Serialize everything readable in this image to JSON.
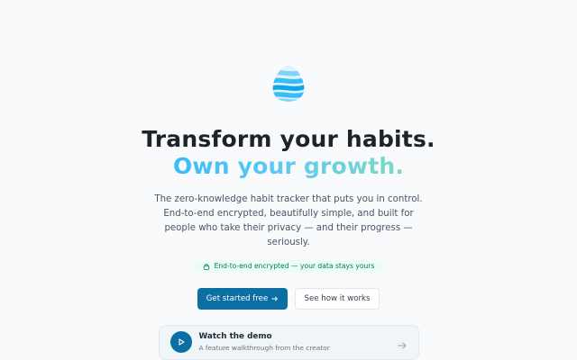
{
  "hero": {
    "title_line1": "Transform your habits.",
    "title_line2": "Own your growth.",
    "description": "The zero-knowledge habit tracker that puts you in control. End-to-end encrypted, beautifully simple, and built for people who take their privacy — and their progress — seriously.",
    "badge": {
      "icon": "lock-icon",
      "text": "End-to-end encrypted — your data stays yours"
    }
  },
  "cta": {
    "primary_label": "Get started free",
    "primary_icon": "arrow-right-icon",
    "secondary_label": "See how it works"
  },
  "demo": {
    "title": "Watch the demo",
    "subtitle": "A feature walkthrough from the creator",
    "play_icon": "play-icon",
    "arrow_icon": "arrow-right-icon"
  },
  "colors": {
    "background": "#f8fafc",
    "primary": "#0b6fa4",
    "gradient_start": "#38bdf8",
    "gradient_end": "#7dd9c0",
    "badge_bg": "#ecfdf5",
    "badge_text": "#047857"
  }
}
